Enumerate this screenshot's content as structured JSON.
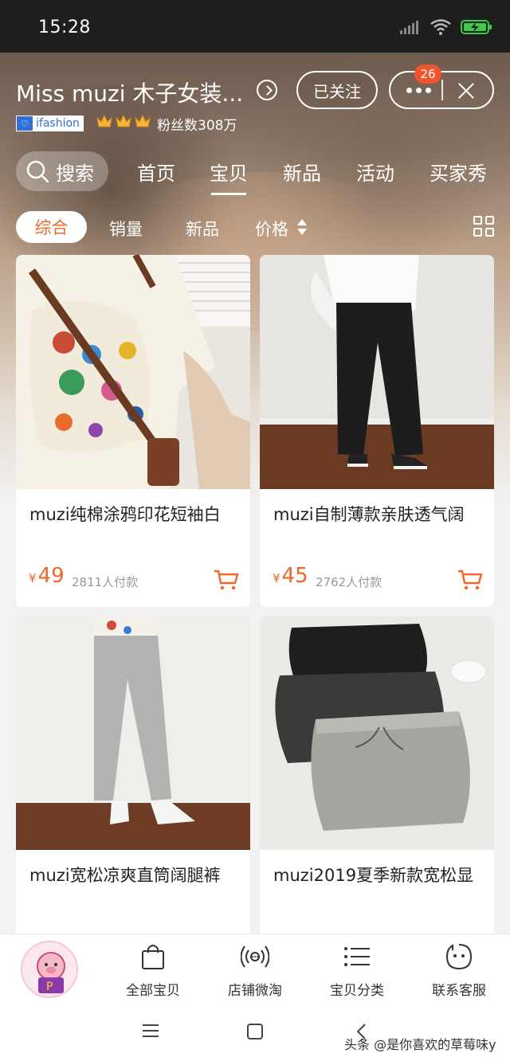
{
  "status_bar": {
    "time": "15:28"
  },
  "shop": {
    "name": "Miss muzi 木子女装...",
    "follow_label": "已关注",
    "badge_count": "26",
    "brand_tag": "ifashion",
    "fans_text": "粉丝数308万"
  },
  "nav": {
    "search_label": "搜索",
    "tabs": [
      {
        "label": "首页"
      },
      {
        "label": "宝贝",
        "active": true
      },
      {
        "label": "新品"
      },
      {
        "label": "活动"
      },
      {
        "label": "买家秀"
      }
    ]
  },
  "sort": {
    "items": [
      {
        "label": "综合",
        "active": true
      },
      {
        "label": "销量"
      },
      {
        "label": "新品"
      },
      {
        "label": "价格"
      }
    ]
  },
  "products": [
    {
      "title": "muzi纯棉涂鸦印花短袖白",
      "currency": "¥",
      "price": "49",
      "sold": "2811人付款"
    },
    {
      "title": "muzi自制薄款亲肤透气阔",
      "currency": "¥",
      "price": "45",
      "sold": "2762人付款"
    },
    {
      "title": "muzi宽松凉爽直筒阔腿裤"
    },
    {
      "title": "muzi2019夏季新款宽松显"
    }
  ],
  "bottom_bar": {
    "items": [
      {
        "label": "全部宝贝",
        "icon": "bag-icon"
      },
      {
        "label": "店铺微淘",
        "icon": "broadcast-icon"
      },
      {
        "label": "宝贝分类",
        "icon": "list-icon"
      },
      {
        "label": "联系客服",
        "icon": "chat-face-icon"
      }
    ]
  },
  "watermark": "头条 @是你喜欢的草莓味y",
  "colors": {
    "accent": "#f2662a",
    "badge": "#f2542d",
    "status_bar": "#1e1e1e"
  }
}
